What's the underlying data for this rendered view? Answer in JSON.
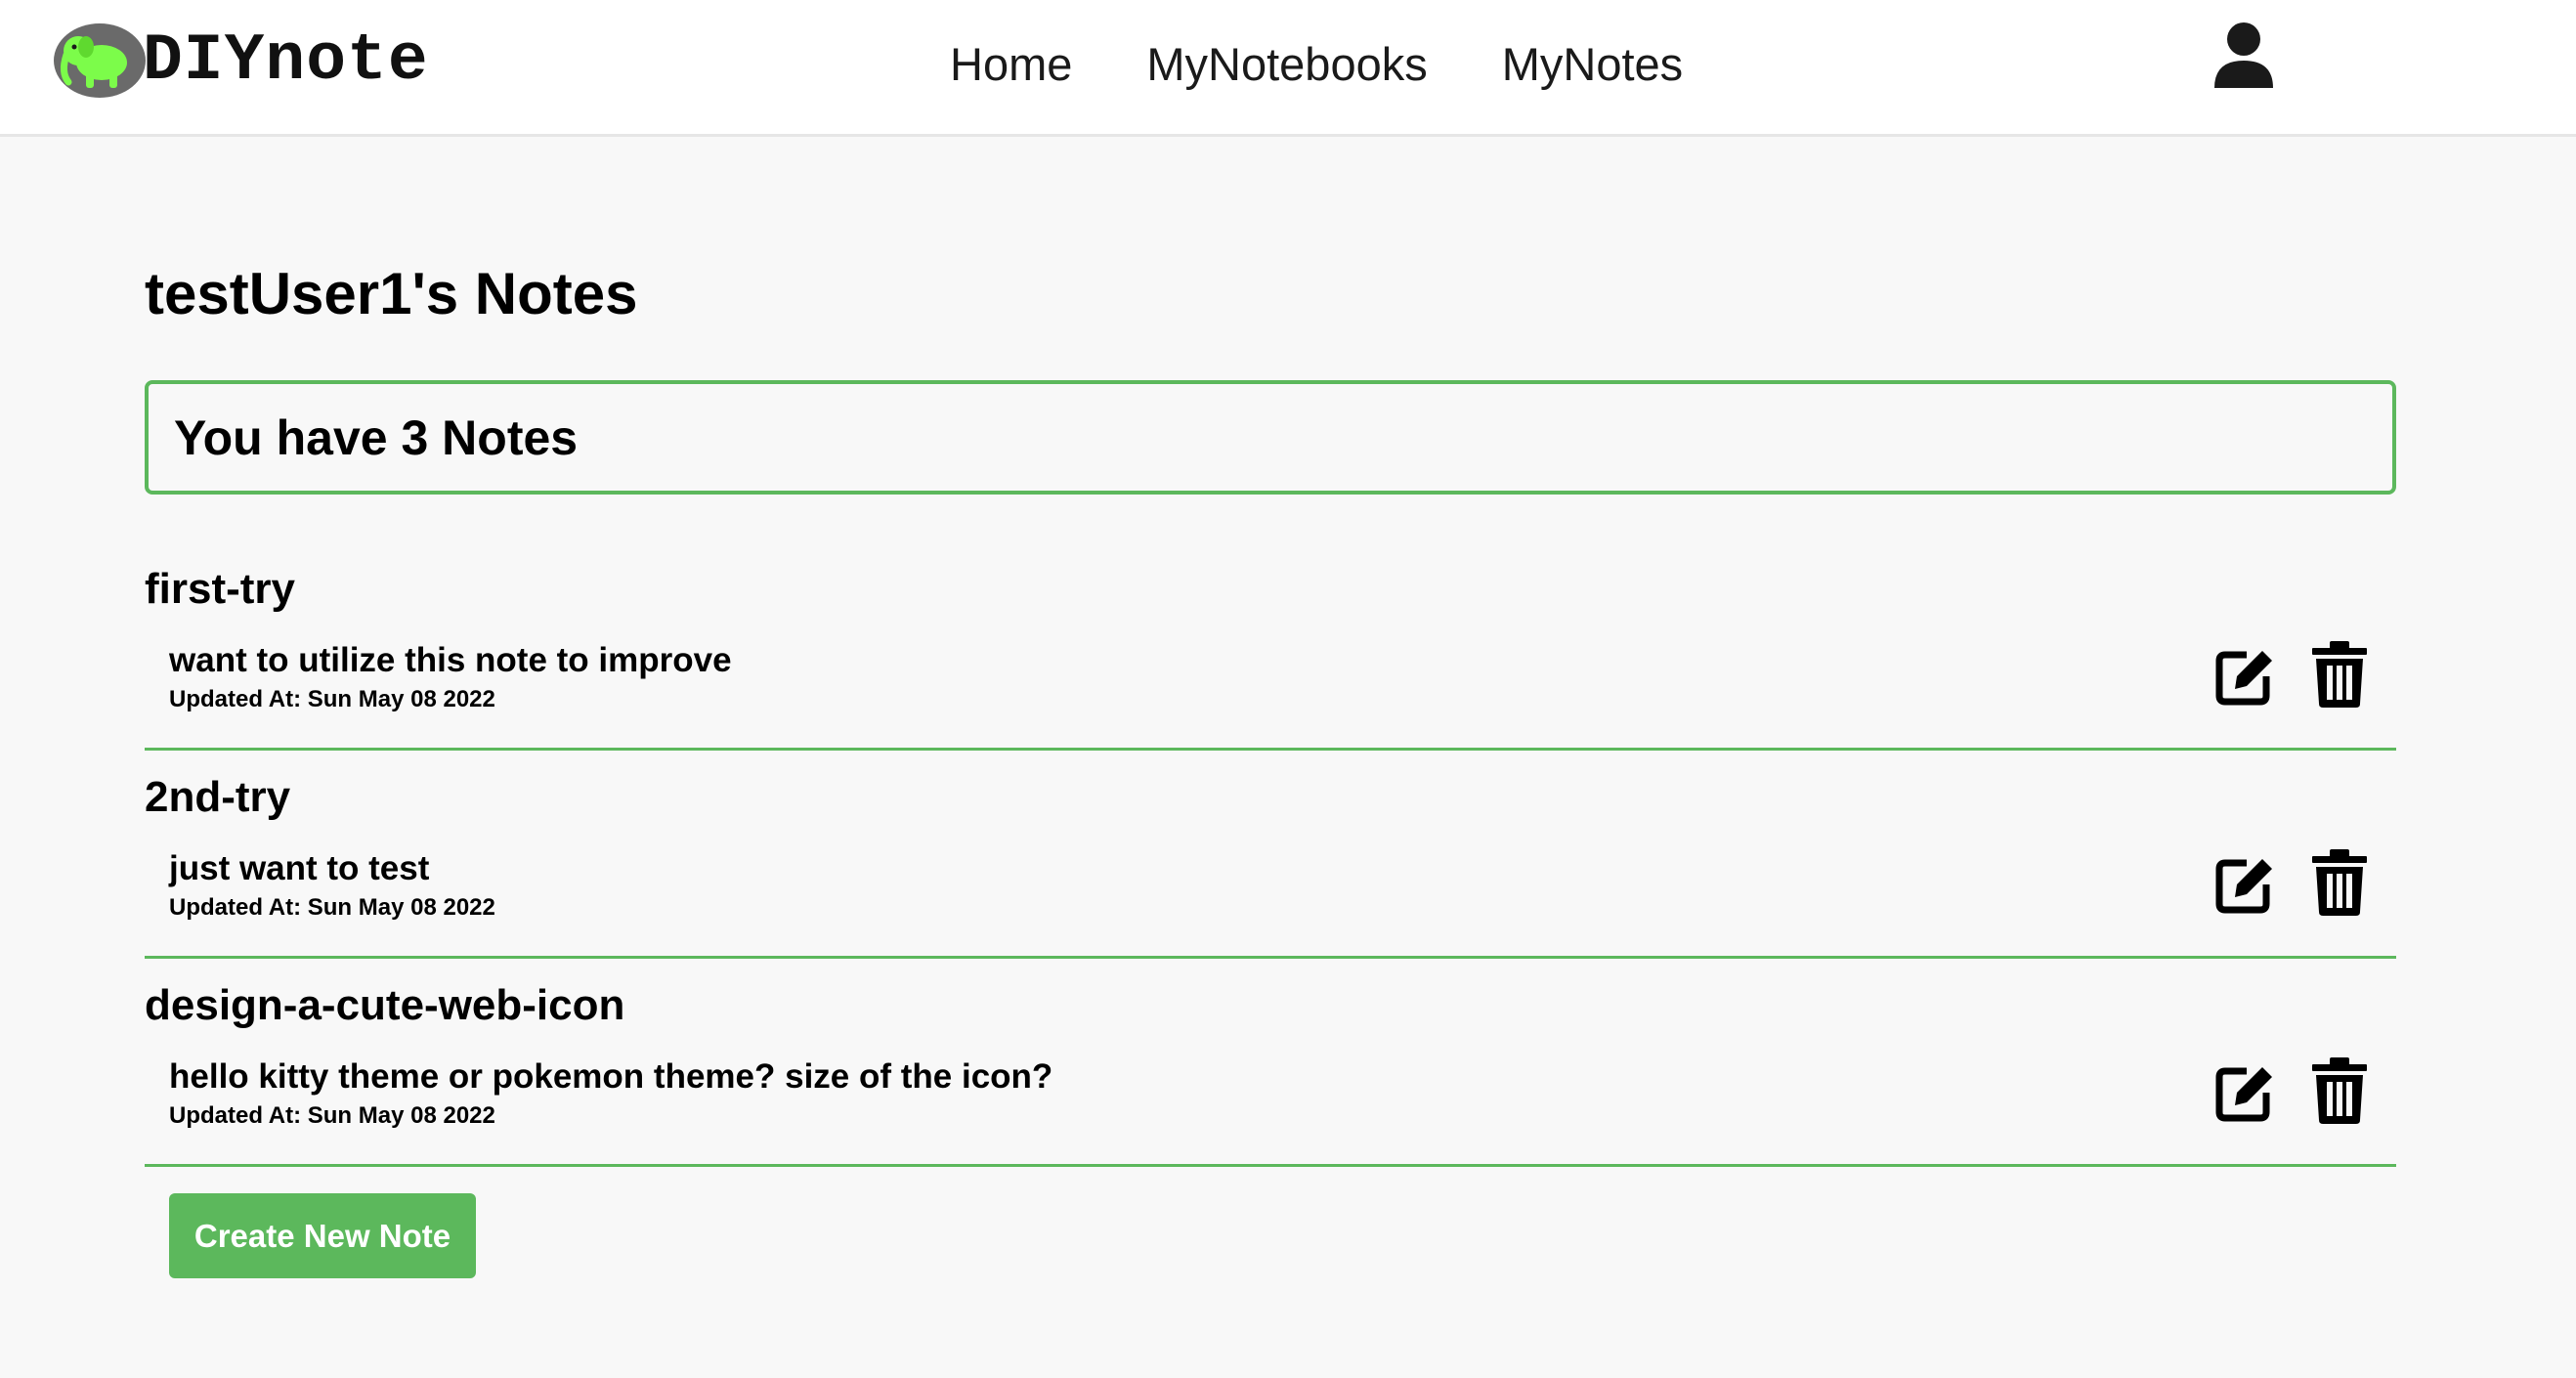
{
  "brand": {
    "name": "DIYnote",
    "icon": "elephant-icon",
    "badge_color": "#6a6a6a",
    "elephant_color": "#7CFC4A"
  },
  "nav": {
    "items": [
      {
        "label": "Home"
      },
      {
        "label": "MyNotebooks"
      },
      {
        "label": "MyNotes"
      }
    ],
    "user_icon": "user-icon"
  },
  "page": {
    "title": "testUser1's Notes",
    "count_text": "You have 3 Notes"
  },
  "notes": [
    {
      "title": "first-try",
      "content": "want to utilize this note to improve",
      "updated": "Updated At: Sun May 08 2022"
    },
    {
      "title": "2nd-try",
      "content": "just want to test",
      "updated": "Updated At: Sun May 08 2022"
    },
    {
      "title": "design-a-cute-web-icon",
      "content": "hello kitty theme or pokemon theme? size of the icon?",
      "updated": "Updated At: Sun May 08 2022"
    }
  ],
  "actions": {
    "edit_icon": "edit-icon",
    "delete_icon": "trash-icon",
    "create_label": "Create New Note"
  },
  "colors": {
    "accent": "#5cb85c",
    "background": "#f8f8f8",
    "navbar": "#ffffff"
  }
}
